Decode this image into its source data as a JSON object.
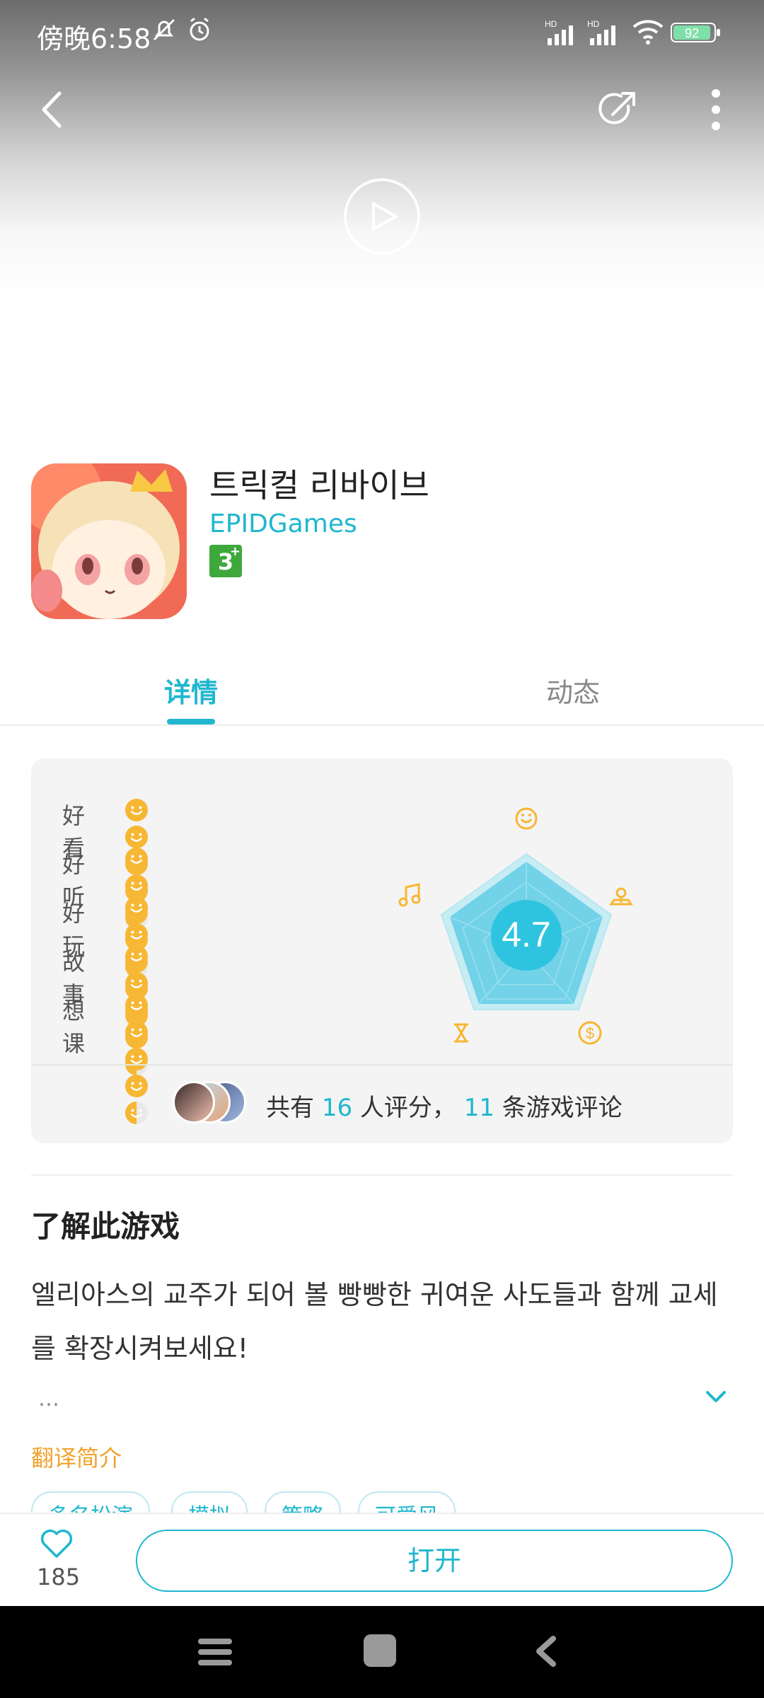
{
  "status_bar": {
    "time": "傍晚6:58",
    "signal_label_1": "HD",
    "signal_label_2": "HD",
    "battery": "92"
  },
  "app": {
    "title": "트릭컬 리바이브",
    "developer": "EPIDGames",
    "age_rating": "3",
    "age_rating_plus": "+"
  },
  "tabs": [
    {
      "label": "详情"
    },
    {
      "label": "动态"
    }
  ],
  "ratings": {
    "score": "4.7",
    "categories": [
      {
        "label": "好看",
        "value": 4.5
      },
      {
        "label": "好听",
        "value": 4.5
      },
      {
        "label": "好玩",
        "value": 5
      },
      {
        "label": "故事",
        "value": 4.5
      },
      {
        "label": "想课",
        "value": 4.5
      }
    ],
    "summary_prefix": "共有",
    "raters": "16",
    "summary_mid": "人评分，",
    "reviews": "11",
    "summary_suffix": "条游戏评论"
  },
  "about": {
    "title": "了解此游戏",
    "description": "엘리아스의 교주가 되어 볼 빵빵한 귀여운 사도들과 함께 교세를 확장시켜보세요!",
    "ellipsis": "…",
    "translate_label": "翻译简介",
    "tags": [
      "多名扮演",
      "模拟",
      "策略",
      "可爱风"
    ]
  },
  "bottom": {
    "likes": "185",
    "open_label": "打开"
  },
  "colors": {
    "accent": "#1fb7cf",
    "face": "#f7b733",
    "translate": "#f0a22a"
  }
}
